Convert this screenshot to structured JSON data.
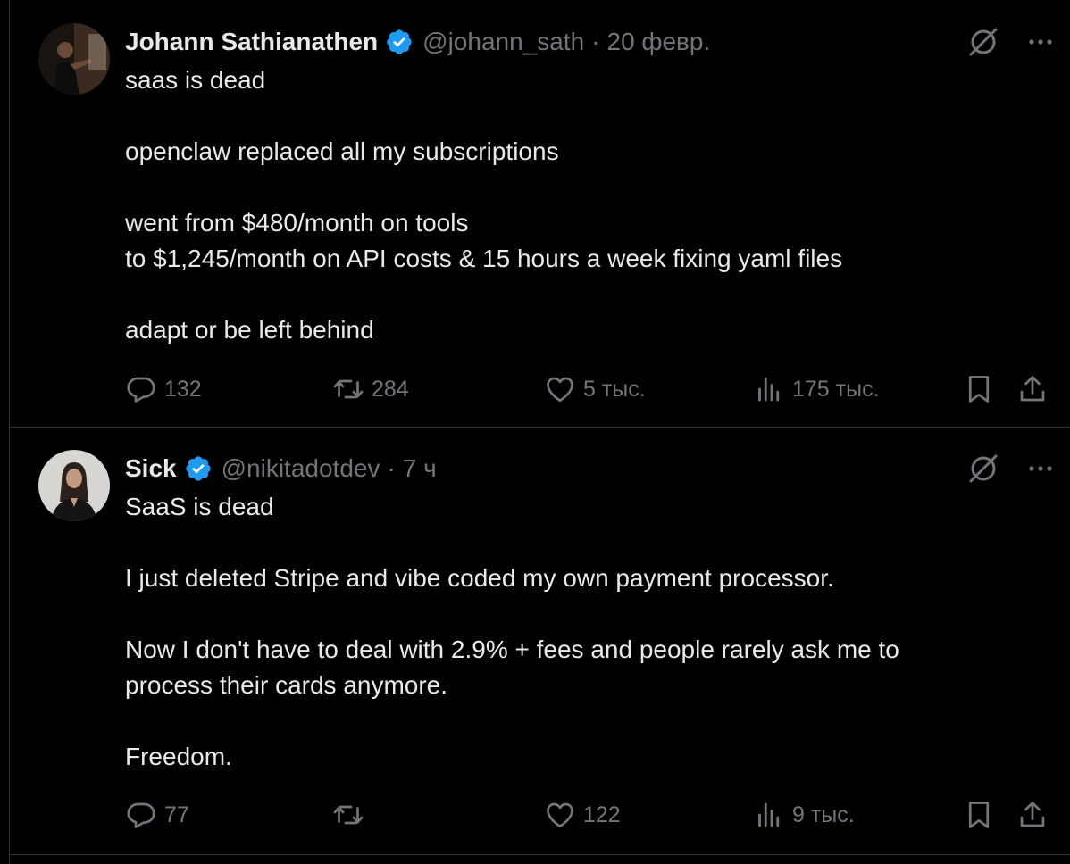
{
  "tweets": [
    {
      "author": {
        "name": "Johann Sathianathen",
        "handle": "@johann_sath",
        "verified": true
      },
      "time": "20 февр.",
      "lines": [
        "saas is dead",
        "openclaw replaced all my subscriptions",
        "went from $480/month on tools\nto $1,245/month on API costs & 15 hours a week fixing yaml files",
        "adapt or be left behind"
      ],
      "stats": {
        "replies": "132",
        "reposts": "284",
        "likes": "5 тыс.",
        "views": "175 тыс."
      }
    },
    {
      "author": {
        "name": "Sick",
        "handle": "@nikitadotdev",
        "verified": true
      },
      "time": "7 ч",
      "lines": [
        "SaaS is dead",
        "I just deleted Stripe and vibe coded my own payment processor.",
        "Now I don't have to deal with 2.9% + fees and people rarely ask me to\nprocess their cards anymore.",
        "Freedom."
      ],
      "stats": {
        "replies": "77",
        "reposts": "",
        "likes": "122",
        "views": "9 тыс."
      }
    }
  ],
  "icons": {
    "verified": "verified-badge-icon",
    "grok": "grok-icon",
    "more": "more-icon",
    "reply": "reply-icon",
    "repost": "repost-icon",
    "like": "like-icon",
    "views": "views-icon",
    "bookmark": "bookmark-icon",
    "share": "share-icon"
  },
  "colors": {
    "background": "#000000",
    "text": "#e7e9ea",
    "muted": "#71767b",
    "border": "#2f3336",
    "verified": "#1d9bf0"
  }
}
